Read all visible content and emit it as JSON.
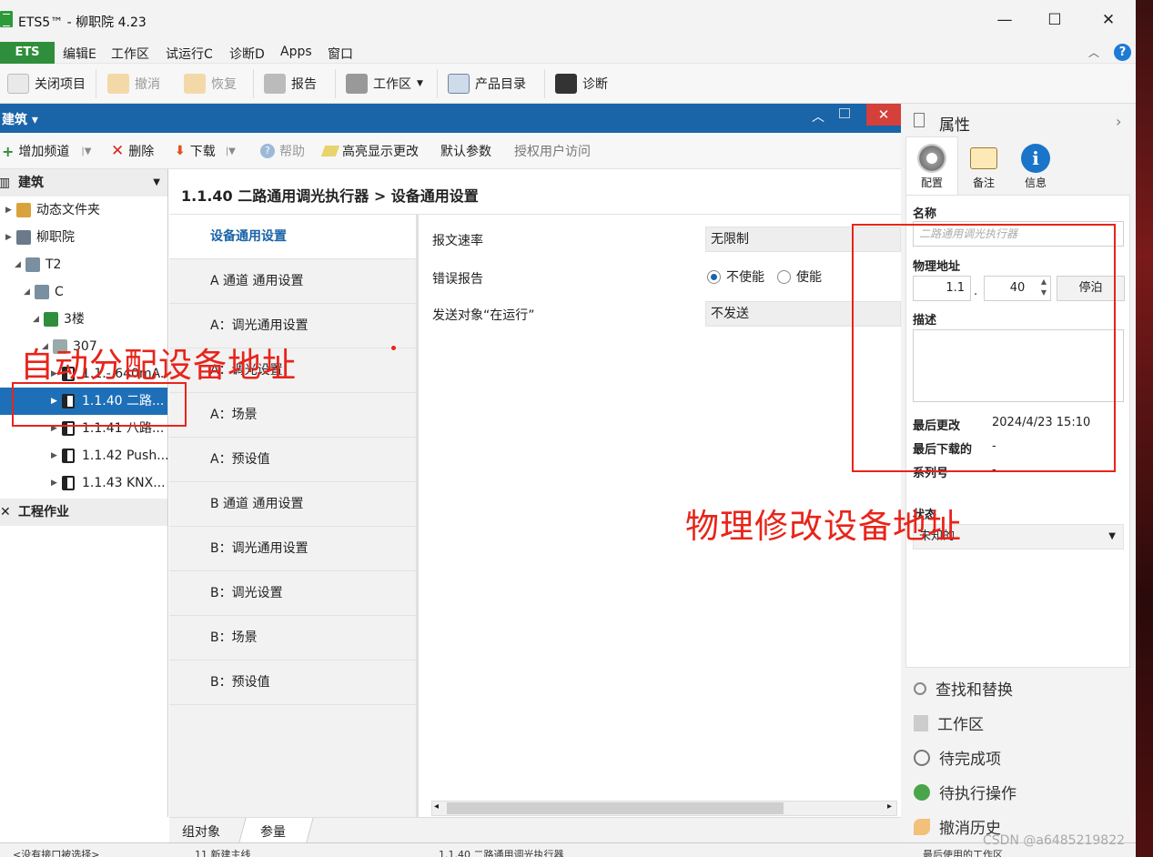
{
  "window": {
    "title": "ETS5™ - 柳职院 4.23",
    "minimize": "—",
    "maximize": "☐",
    "close": "✕"
  },
  "menu": {
    "ets": "ETS",
    "items": [
      "编辑E",
      "工作区",
      "试运行C",
      "诊断D",
      "Apps",
      "窗口"
    ],
    "help": "?"
  },
  "toolbar": {
    "close_project": "关闭项目",
    "undo": "撤消",
    "redo": "恢复",
    "report": "报告",
    "workspace": "工作区",
    "catalog": "产品目录",
    "diagnose": "诊断"
  },
  "panel": {
    "title": "建筑 ▾"
  },
  "toolbar2": {
    "add_channel": "增加频道",
    "delete": "删除",
    "download": "下载",
    "help": "帮助",
    "highlight": "高亮显示更改",
    "default_params": "默认参数",
    "auth": "授权用户访问"
  },
  "tree": {
    "header": "建筑",
    "header2": "工程作业",
    "rows": [
      {
        "label": "动态文件夹",
        "indent": 1
      },
      {
        "label": "柳职院",
        "indent": 1
      },
      {
        "label": "T2",
        "indent": 2
      },
      {
        "label": "C",
        "indent": 3
      },
      {
        "label": "3楼",
        "indent": 4
      },
      {
        "label": "307",
        "indent": 5
      },
      {
        "label": "1.1.- 640mA...",
        "indent": 6
      },
      {
        "label": "1.1.40 二路...",
        "indent": 6,
        "selected": true
      },
      {
        "label": "1.1.41 八路...",
        "indent": 6
      },
      {
        "label": "1.1.42 Push...",
        "indent": 6
      },
      {
        "label": "1.1.43 KNX...",
        "indent": 6
      }
    ]
  },
  "breadcrumb": "1.1.40 二路通用调光执行器 > 设备通用设置",
  "pages": [
    "设备通用设置",
    "A 通道 通用设置",
    "A：调光通用设置",
    "A：调光设置",
    "A：场景",
    "A：预设值",
    "B 通道 通用设置",
    "B：调光通用设置",
    "B：调光设置",
    "B：场景",
    "B：预设值"
  ],
  "params": {
    "rate_label": "报文速率",
    "rate_value": "无限制",
    "error_label": "错误报告",
    "error_opt1": "不使能",
    "error_opt2": "使能",
    "send_label": "发送对象“在运行”",
    "send_value": "不发送"
  },
  "bottom_tabs": [
    "组对象",
    "参量"
  ],
  "status": {
    "left": "<没有接口被选择>",
    "mid1": "11 新建主线",
    "mid2": "1.1.40 二路通用调光执行器",
    "right": "最后使用的工作区"
  },
  "properties": {
    "header": "属性",
    "tabs": [
      "配置",
      "备注",
      "信息"
    ],
    "name_label": "名称",
    "name_placeholder": "二路通用调光执行器",
    "phys_label": "物理地址",
    "phys_prefix": "1.1",
    "phys_dot": ".",
    "phys_value": "40",
    "park_button": "停泊",
    "desc_label": "描述",
    "last_change_label": "最后更改",
    "last_change_value": "2024/4/23 15:10",
    "last_download_label": "最后下载的",
    "last_download_value": "-",
    "serial_label": "系列号",
    "serial_value": "-",
    "state_label": "状态",
    "state_value": "未知的"
  },
  "dock": [
    "查找和替换",
    "工作区",
    "待完成项",
    "待执行操作",
    "撤消历史"
  ],
  "annotations": {
    "auto": "自动分配设备地址",
    "manual": "物理修改设备地址"
  },
  "watermark": "CSDN @a6485219822",
  "colors": {
    "blue": "#1a64a8",
    "green": "#2f8e3b",
    "red": "#e8241a"
  }
}
